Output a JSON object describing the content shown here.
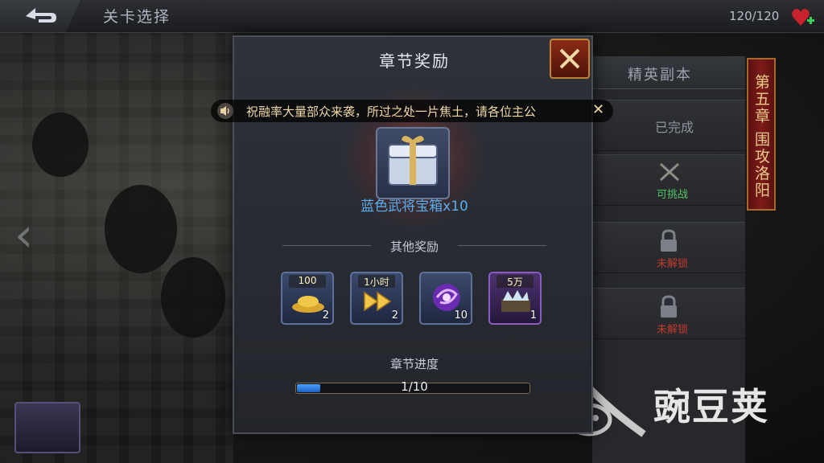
{
  "topbar": {
    "title": "关卡选择",
    "stamina": "120/120"
  },
  "right_panel": {
    "tab_label": "精英副本",
    "rows": [
      {
        "status": "已完成",
        "icon": "none"
      },
      {
        "status": "可挑战",
        "icon": "crossed-swords-icon"
      },
      {
        "status": "未解锁",
        "icon": "lock-icon"
      },
      {
        "status": "未解锁",
        "icon": "lock-icon"
      }
    ],
    "chapter_banner": "第五章 围攻洛阳"
  },
  "watermark": {
    "text": "豌豆荚"
  },
  "notice": {
    "text": "祝融率大量部众来袭，所过之处一片焦土，请各位主公"
  },
  "modal": {
    "title": "章节奖励",
    "main_reward": {
      "name": "蓝色武将宝箱x10",
      "icon": "treasure-chest-icon"
    },
    "other_rewards_label": "其他奖励",
    "items": [
      {
        "top_label": "100",
        "count": "2",
        "icon": "gold-pile-icon",
        "rarity": "blue"
      },
      {
        "top_label": "1小时",
        "count": "2",
        "icon": "fast-forward-icon",
        "rarity": "blue"
      },
      {
        "top_label": "",
        "count": "10",
        "icon": "purple-orb-icon",
        "rarity": "blue"
      },
      {
        "top_label": "5万",
        "count": "1",
        "icon": "silver-chest-icon",
        "rarity": "purple"
      }
    ],
    "progress": {
      "label": "章节进度",
      "text": "1/10",
      "fraction": 0.1
    }
  },
  "colors": {
    "reward_name": "#58aef0",
    "progress_fill": "#2f84e8",
    "banner": "#7c1c18",
    "close_button": "#8a2a16"
  }
}
